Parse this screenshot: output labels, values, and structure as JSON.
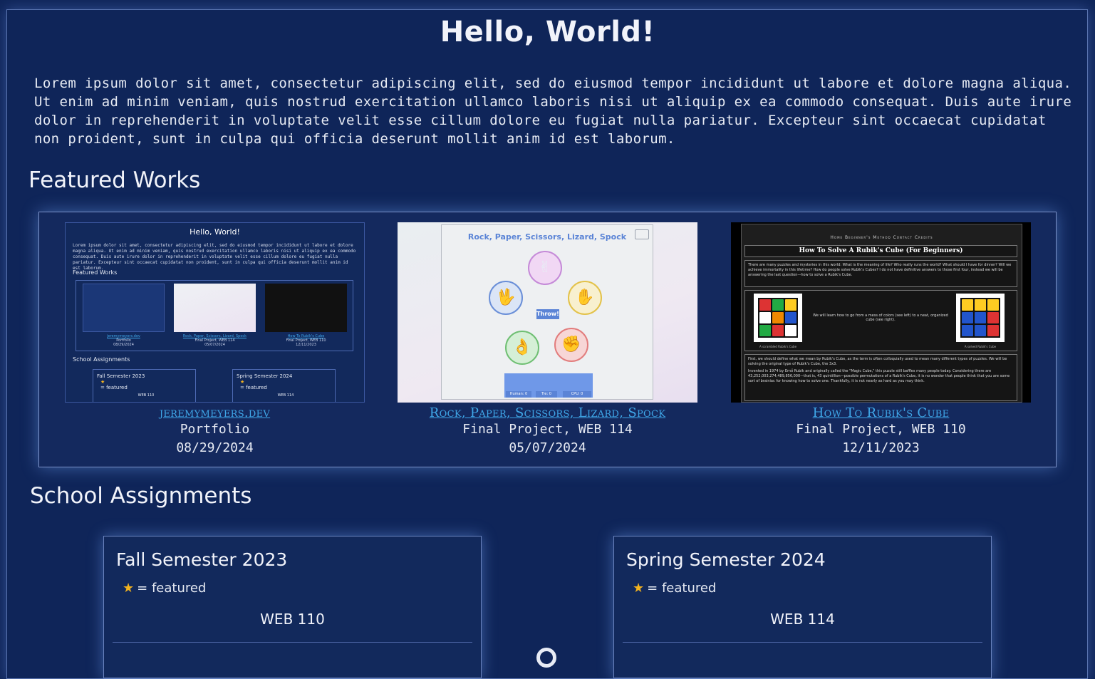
{
  "page": {
    "title": "Hello, World!",
    "intro": "Lorem ipsum dolor sit amet, consectetur adipiscing elit, sed do eiusmod tempor incididunt ut labore et dolore magna aliqua. Ut enim ad minim veniam, quis nostrud exercitation ullamco laboris nisi ut aliquip ex ea commodo consequat. Duis aute irure dolor in reprehenderit in voluptate velit esse cillum dolore eu fugiat nulla pariatur. Excepteur sint occaecat cupidatat non proident, sunt in culpa qui officia deserunt mollit anim id est laborum."
  },
  "featured": {
    "heading": "Featured Works",
    "works": [
      {
        "link": "jeremymeyers.dev",
        "subtitle": "Portfolio",
        "date": "08/29/2024"
      },
      {
        "link": "Rock, Paper, Scissors, Lizard, Spock",
        "subtitle": "Final Project, WEB 114",
        "date": "05/07/2024"
      },
      {
        "link": "How To Rubik's Cube",
        "subtitle": "Final Project, WEB 110",
        "date": "12/11/2023"
      }
    ]
  },
  "thumb1": {
    "title": "Hello, World!",
    "text": "Lorem ipsum dolor sit amet, consectetur adipiscing elit, sed do eiusmod tempor incididunt ut labore et dolore magna aliqua. Ut enim ad minim veniam, quis nostrud exercitation ullamco laboris nisi ut aliquip ex ea commodo consequat. Duis aute irure dolor in reprehenderit in voluptate velit esse cillum dolore eu fugiat nulla pariatur. Excepteur sint occaecat cupidatat non proident, sunt in culpa qui officia deserunt mollit anim id est laborum.",
    "featured_heading": "Featured Works",
    "school_heading": "School Assignments",
    "cards": [
      {
        "link": "jeremymeyers.dev",
        "sub": "Portfolio",
        "date": "08/29/2024"
      },
      {
        "link": "Rock, Paper, Scissors, Lizard, Spock",
        "sub": "Final Project, WEB 114",
        "date": "05/07/2024"
      },
      {
        "link": "How To Rubik's Cube",
        "sub": "Final Project, WEB 110",
        "date": "12/11/2023"
      }
    ],
    "semesters": [
      {
        "title": "Fall Semester 2023",
        "legend": "= featured",
        "course": "WEB 110"
      },
      {
        "title": "Spring Semester 2024",
        "legend": "= featured",
        "course": "WEB 114"
      }
    ]
  },
  "thumb2": {
    "title": "Rock, Paper, Scissors, Lizard, Spock",
    "throw": "Throw!",
    "scores": [
      "Human: 0",
      "Tie: 0",
      "CPU: 0"
    ]
  },
  "thumb3": {
    "nav": "Home   Beginner's Method   Contact   Credits",
    "title": "How To Solve A Rubik's Cube (For Beginners)",
    "intro": "There are many puzzles and mysteries in this world: What is the meaning of life? Who really runs the world? What should I have for dinner? Will we achieve immortality in this lifetime? How do people solve Rubik's Cubes? I do not have definitive answers to those first four, instead we will be answering the last question—how to solve a Rubik's Cube.",
    "middle": "We will learn how to go from a mess of colors (see left) to a neat, organized cube (see right).",
    "cap_left": "A scrambled Rubik's Cube",
    "cap_right": "A solved Rubik's Cube",
    "p1": "First, we should define what we mean by Rubik's Cube, as the term is often colloquially used to mean many different types of puzzles. We will be solving the original type of Rubik's Cube, the 3x3.",
    "p2": "Invented in 1974 by Ernő Rubik and originally called the \"Magic Cube,\" this puzzle still baffles many people today. Considering there are 43,252,003,274,489,856,000—that is, 43 quintillion—possible permutations of a Rubik's Cube, it is no wonder that people think that you are some sort of brainiac for knowing how to solve one. Thankfully, it is not nearly as hard as you may think."
  },
  "school": {
    "heading": "School Assignments",
    "semesters": [
      {
        "title": "Fall Semester 2023",
        "legend": "= featured",
        "course": "WEB 110"
      },
      {
        "title": "Spring Semester 2024",
        "legend": "= featured",
        "course": "WEB 114"
      }
    ]
  },
  "colors": {
    "background": "#0f2559",
    "link": "#3fa7e8",
    "star": "#f2b21f"
  },
  "icons": [
    "star-icon",
    "scroll-indicator-icon",
    "book-icon"
  ]
}
